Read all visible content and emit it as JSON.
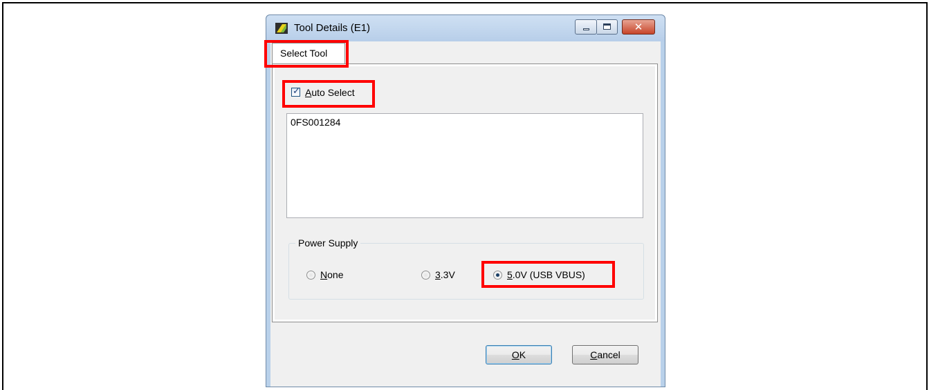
{
  "window": {
    "title": "Tool Details (E1)"
  },
  "tabs": [
    {
      "label": "Select Tool",
      "active": true
    }
  ],
  "auto_select": {
    "label_prefix": "",
    "label_accel": "A",
    "label_rest": "uto Select",
    "checked": true
  },
  "tool_list": {
    "items": [
      "0FS001284"
    ]
  },
  "power_supply": {
    "legend": "Power Supply",
    "options": [
      {
        "accel": "N",
        "rest": "one",
        "checked": false
      },
      {
        "accel": "3",
        "rest": ".3V",
        "checked": false
      },
      {
        "accel": "5",
        "rest": ".0V (USB VBUS)",
        "checked": true
      }
    ]
  },
  "buttons": {
    "ok": {
      "accel": "O",
      "rest": "K"
    },
    "cancel": {
      "accel": "C",
      "rest": "ancel"
    }
  },
  "colors": {
    "highlight": "#ff0000",
    "title_bar": "#b9d1ea",
    "dialog_face": "#f0f0f0"
  },
  "icons": {
    "app": "yellow-green-app-icon",
    "minimize": "minimize-icon",
    "maximize": "maximize-icon",
    "close": "close-icon"
  }
}
